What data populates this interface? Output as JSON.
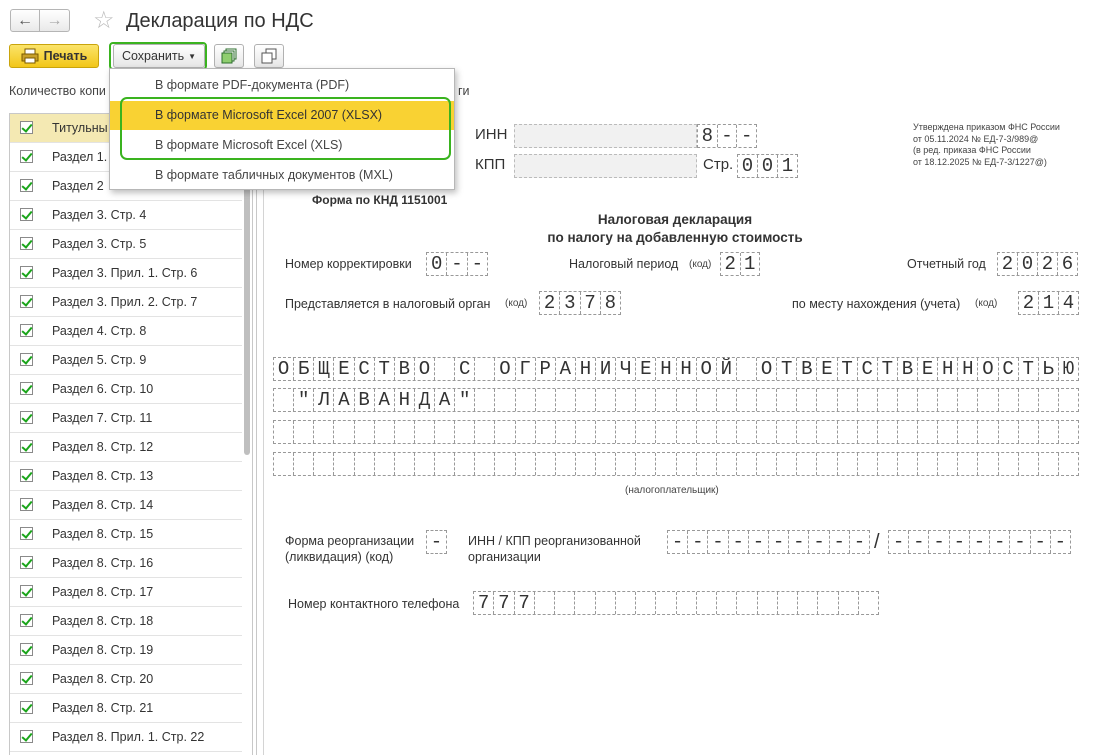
{
  "header": {
    "title": "Декларация по НДС",
    "back": "←",
    "forward": "→",
    "star": "☆"
  },
  "toolbar": {
    "print_label": "Печать",
    "save_label": "Сохранить",
    "copies_label": "Количество копи",
    "copies_tail": "ги"
  },
  "save_menu": [
    "В формате PDF-документа (PDF)",
    "В формате Microsoft Excel 2007 (XLSX)",
    "В формате Microsoft Excel (XLS)",
    "В формате табличных документов (MXL)"
  ],
  "sections": [
    "Титульны",
    "Раздел 1.",
    "Раздел 2",
    "Раздел 3. Стр. 4",
    "Раздел 3. Стр. 5",
    "Раздел 3. Прил. 1. Стр. 6",
    "Раздел 3. Прил. 2. Стр. 7",
    "Раздел 4. Стр. 8",
    "Раздел 5. Стр. 9",
    "Раздел 6. Стр. 10",
    "Раздел 7. Стр. 11",
    "Раздел 8. Стр. 12",
    "Раздел 8. Стр. 13",
    "Раздел 8. Стр. 14",
    "Раздел 8. Стр. 15",
    "Раздел 8. Стр. 16",
    "Раздел 8. Стр. 17",
    "Раздел 8. Стр. 18",
    "Раздел 8. Стр. 19",
    "Раздел 8. Стр. 20",
    "Раздел 8. Стр. 21",
    "Раздел 8. Прил. 1. Стр. 22"
  ],
  "doc": {
    "inn_label": "ИНН",
    "kpp_label": "КПП",
    "page_label": "Стр.",
    "page_value": "001",
    "inn_visible": "8--",
    "order_lines": [
      "Утверждена приказом ФНС России",
      "от 05.11.2024 № ЕД-7-3/989@",
      "(в ред. приказа ФНС России",
      "от 18.12.2025 № ЕД-7-3/1227@)"
    ],
    "form_code": "Форма по КНД 1151001",
    "title1": "Налоговая декларация",
    "title2": "по налогу на добавленную стоимость",
    "corr_label": "Номер корректировки",
    "corr_value": "0--",
    "period_label": "Налоговый период",
    "kod": "(код)",
    "period_value": "21",
    "year_label": "Отчетный год",
    "year_value": "2026",
    "authority_label": "Представляется в налоговый орган",
    "authority_value": "2378",
    "location_label": "по месту нахождения (учета)",
    "location_value": "214",
    "org_line1": "ОБЩЕСТВО С ОГРАНИЧЕННОЙ ОТВЕТСТВЕННОСТЬЮ",
    "org_line2": " \"ЛАВАНДА\"",
    "taxpayer_label": "(налогоплательщик)",
    "reorg_label1": "Форма реорганизации",
    "reorg_label2": "(ликвидация) (код)",
    "reorg_value": "-",
    "reorg_inn_label1": "ИНН / КПП реорганизованной",
    "reorg_inn_label2": "организации",
    "reorg_inn_value": "----------",
    "reorg_kpp_value": "---------",
    "phone_label": "Номер контактного телефона",
    "phone_value": "777"
  }
}
